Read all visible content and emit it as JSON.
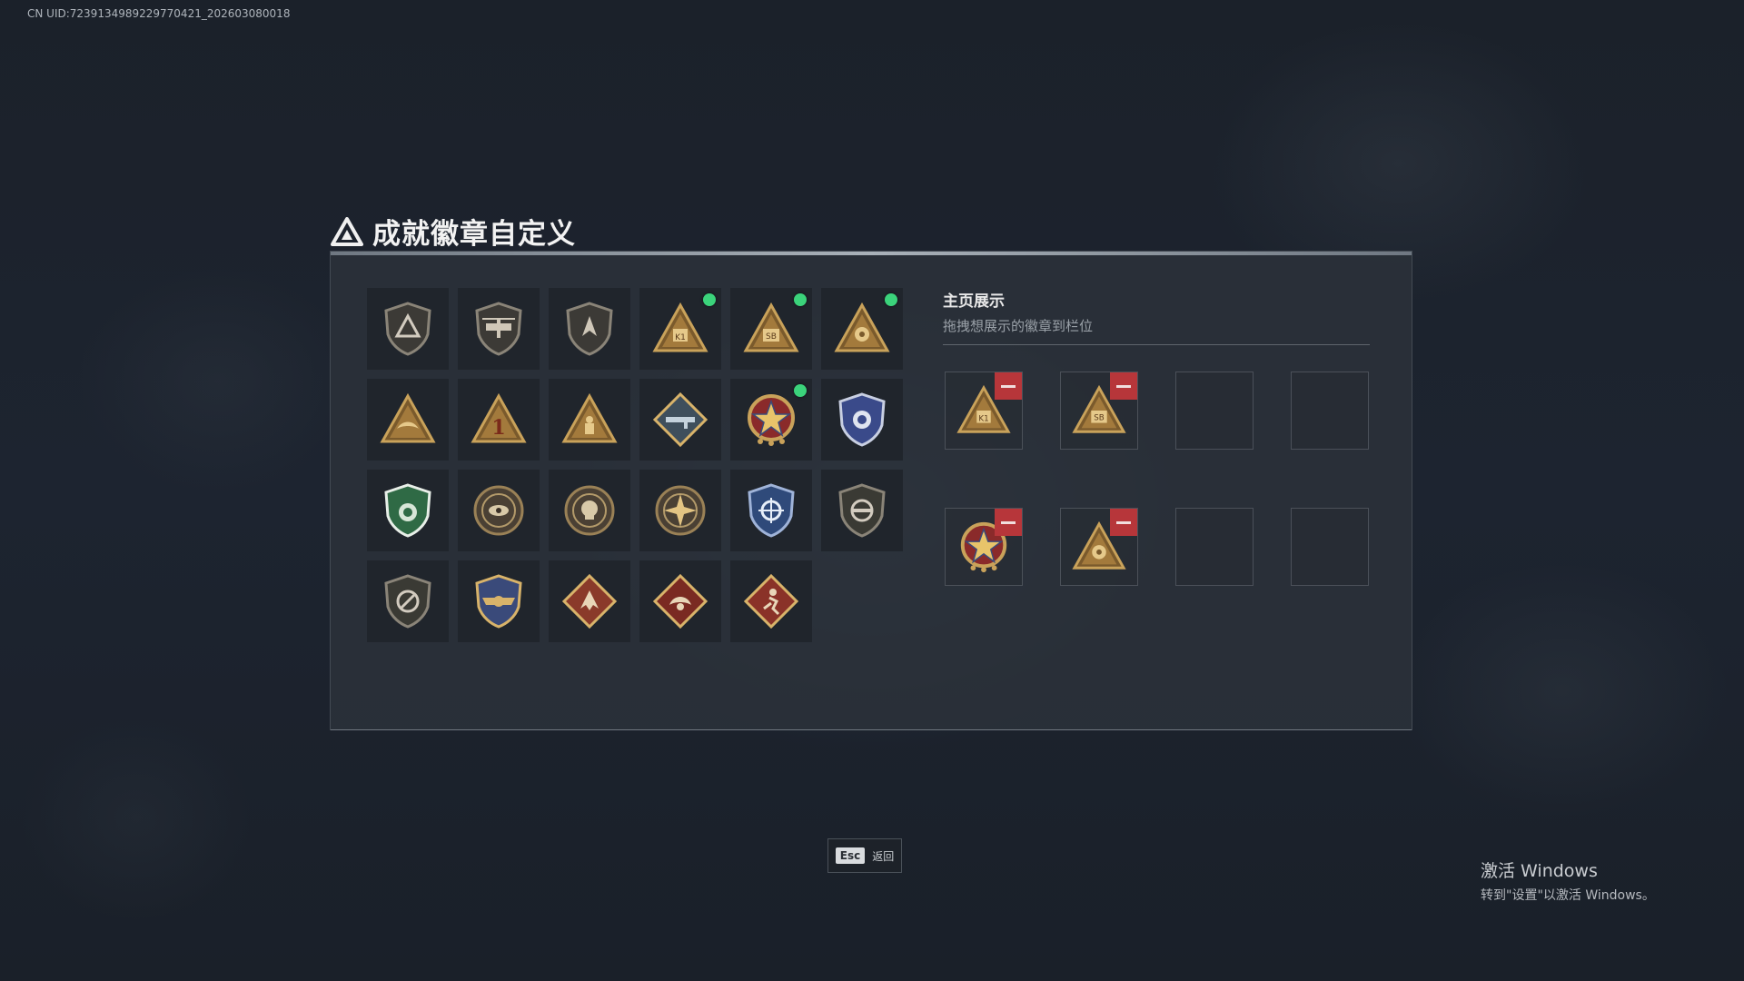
{
  "uid_text": "CN UID:7239134989229770421_202603080018",
  "title": "成就徽章自定义",
  "right_panel": {
    "title": "主页展示",
    "subtitle": "拖拽想展示的徽章到栏位"
  },
  "badges": [
    {
      "icon": "shield-triangle-icon",
      "new": false
    },
    {
      "icon": "helicopter-shield-icon",
      "new": false
    },
    {
      "icon": "wing-shield-icon",
      "new": false
    },
    {
      "icon": "gold-triangle-k1-icon",
      "new": true
    },
    {
      "icon": "gold-triangle-sb-icon",
      "new": true
    },
    {
      "icon": "gold-triangle-gear-icon",
      "new": true
    },
    {
      "icon": "gold-triangle-eagle-icon",
      "new": false
    },
    {
      "icon": "gold-triangle-number-one-icon",
      "new": false
    },
    {
      "icon": "gold-triangle-soldier-icon",
      "new": false
    },
    {
      "icon": "diamond-rifle-icon",
      "new": false
    },
    {
      "icon": "star-medal-icon",
      "new": true
    },
    {
      "icon": "blue-police-shield-icon",
      "new": false
    },
    {
      "icon": "green-lion-shield-icon",
      "new": false
    },
    {
      "icon": "round-eye-emblem-icon",
      "new": false
    },
    {
      "icon": "round-skull-emblem-icon",
      "new": false
    },
    {
      "icon": "starburst-emblem-icon",
      "new": false
    },
    {
      "icon": "blue-crosshair-shield-icon",
      "new": false
    },
    {
      "icon": "rifle-crosshair-shield-icon",
      "new": false
    },
    {
      "icon": "bow-crosshair-shield-icon",
      "new": false
    },
    {
      "icon": "gold-wings-shield-icon",
      "new": false
    },
    {
      "icon": "red-diamond-wolf-icon",
      "new": false
    },
    {
      "icon": "red-diamond-dragon-icon",
      "new": false
    },
    {
      "icon": "red-diamond-runner-icon",
      "new": false
    }
  ],
  "slots": [
    {
      "icon": "gold-triangle-k1-icon"
    },
    {
      "icon": "gold-triangle-sb-icon"
    },
    {
      "icon": ""
    },
    {
      "icon": ""
    },
    {
      "icon": "star-medal-icon"
    },
    {
      "icon": "gold-triangle-gear-icon"
    },
    {
      "icon": ""
    },
    {
      "icon": ""
    }
  ],
  "esc": {
    "key": "Esc",
    "label": "返回"
  },
  "watermark": {
    "line1": "激活 Windows",
    "line2": "转到\"设置\"以激活 Windows。"
  },
  "colors": {
    "new_dot": "#3bd37b",
    "remove": "#b7363a",
    "gold": "#c9a25a",
    "bronze": "#8a6a3c"
  }
}
